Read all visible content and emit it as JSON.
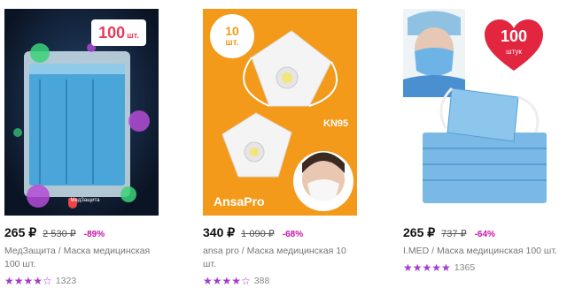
{
  "products": [
    {
      "image": {
        "badge_number": "100",
        "badge_unit": "шт.",
        "brand_text": "МедЗащита"
      },
      "price": "265 ₽",
      "old_price": "2 530 ₽",
      "discount": "-89%",
      "brand": "МедЗащита",
      "title": "Маска медицинская 100 шт.",
      "rating": 4,
      "reviews": "1323"
    },
    {
      "image": {
        "badge_number": "10",
        "badge_unit": "шт.",
        "label_kn95": "KN95",
        "label_brand": "AnsaPro"
      },
      "price": "340 ₽",
      "old_price": "1 090 ₽",
      "discount": "-68%",
      "brand": "ansa pro",
      "title": "Маска медицинская 10 шт.",
      "rating": 4,
      "reviews": "388"
    },
    {
      "image": {
        "badge_number": "100",
        "badge_unit": "штук"
      },
      "price": "265 ₽",
      "old_price": "737 ₽",
      "discount": "-64%",
      "brand": "I.MED",
      "title": "Маска медицинская 100 шт.",
      "rating": 5,
      "reviews": "1365"
    }
  ],
  "colors": {
    "accent": "#cb11ab",
    "star": "#a33bcf",
    "card2_bg": "#f39a1b",
    "card1_bg": "#0e1a2e"
  }
}
